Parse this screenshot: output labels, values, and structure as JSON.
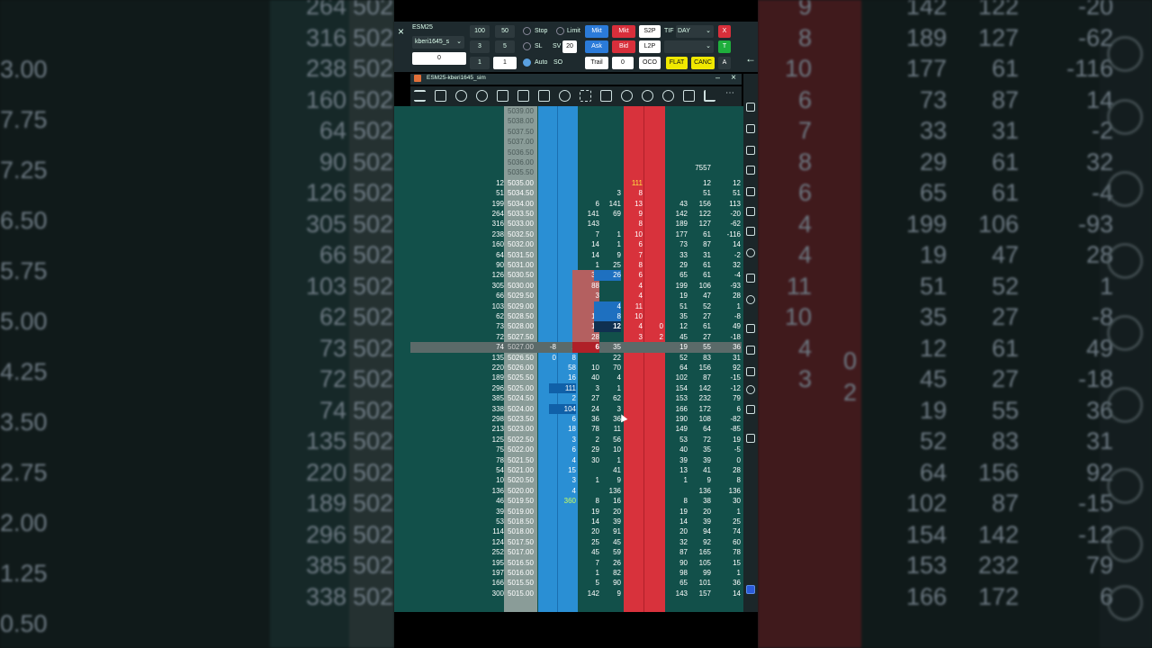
{
  "toolbar": {
    "symbol": "ESM25",
    "account": "kberi1645_s",
    "price_field": "0",
    "qty_presets": [
      "100",
      "50",
      "3",
      "5",
      "1"
    ],
    "qty_value": "1",
    "sv_label": "SV",
    "sv_value": "20",
    "stop_label": "Stop",
    "limit_label": "Limit",
    "sl_label": "SL",
    "auto_label": "Auto",
    "so_label": "SO",
    "mkt_buy": "Mkt",
    "mkt_sell": "Mkt",
    "ask": "Ask",
    "bid": "Bid",
    "trail": "Trail",
    "trail_value": "0",
    "s2p": "S2P",
    "l2p": "L2P",
    "oco": "OCO",
    "tif_label": "TIF",
    "tif_value": "DAY",
    "flat": "FLAT",
    "canc": "CANC",
    "a_label": "A",
    "x_label": "X",
    "t_label": "T",
    "close_icon": "×"
  },
  "window": {
    "title": "ESM25-kberi1645_sim",
    "logo_letter": "K"
  },
  "ladder": {
    "hidden_prices": [
      "5039.00",
      "5038.00",
      "5037.50",
      "5037.00",
      "5036.50",
      "5036.00",
      "5035.50"
    ],
    "total_volume": "7557",
    "rows": [
      {
        "vol": "12",
        "price": "5035.00",
        "a": "",
        "b": "",
        "c": "",
        "d": "",
        "ask": "111",
        "e": "",
        "f": "",
        "g": "12",
        "h": "12"
      },
      {
        "vol": "51",
        "price": "5034.50",
        "a": "",
        "b": "",
        "c": "",
        "d": "3",
        "ask": "8",
        "e": "",
        "f": "",
        "g": "51",
        "h": "51"
      },
      {
        "vol": "199",
        "price": "5034.00",
        "a": "",
        "b": "",
        "c": "6",
        "d": "141",
        "ask": "13",
        "e": "",
        "f": "43",
        "g": "156",
        "h": "113"
      },
      {
        "vol": "264",
        "price": "5033.50",
        "a": "",
        "b": "",
        "c": "141",
        "d": "69",
        "ask": "9",
        "e": "",
        "f": "142",
        "g": "122",
        "h": "-20"
      },
      {
        "vol": "316",
        "price": "5033.00",
        "a": "",
        "b": "",
        "c": "143",
        "d": "",
        "ask": "8",
        "e": "",
        "f": "189",
        "g": "127",
        "h": "-62"
      },
      {
        "vol": "238",
        "price": "5032.50",
        "a": "",
        "b": "",
        "c": "7",
        "d": "1",
        "ask": "10",
        "e": "",
        "f": "177",
        "g": "61",
        "h": "-116"
      },
      {
        "vol": "160",
        "price": "5032.00",
        "a": "",
        "b": "",
        "c": "14",
        "d": "1",
        "ask": "6",
        "e": "",
        "f": "73",
        "g": "87",
        "h": "14"
      },
      {
        "vol": "64",
        "price": "5031.50",
        "a": "",
        "b": "",
        "c": "14",
        "d": "9",
        "ask": "7",
        "e": "",
        "f": "33",
        "g": "31",
        "h": "-2"
      },
      {
        "vol": "90",
        "price": "5031.00",
        "a": "",
        "b": "",
        "c": "1",
        "d": "25",
        "ask": "8",
        "e": "",
        "f": "29",
        "g": "61",
        "h": "32"
      },
      {
        "vol": "126",
        "price": "5030.50",
        "a": "",
        "b": "",
        "c": "37",
        "d": "26",
        "ask": "6",
        "e": "",
        "f": "65",
        "g": "61",
        "h": "-4"
      },
      {
        "vol": "305",
        "price": "5030.00",
        "a": "",
        "b": "",
        "c": "88",
        "d": "",
        "ask": "4",
        "e": "",
        "f": "199",
        "g": "106",
        "h": "-93"
      },
      {
        "vol": "66",
        "price": "5029.50",
        "a": "",
        "b": "",
        "c": "3",
        "d": "",
        "ask": "4",
        "e": "",
        "f": "19",
        "g": "47",
        "h": "28"
      },
      {
        "vol": "103",
        "price": "5029.00",
        "a": "",
        "b": "",
        "c": "3",
        "d": "4",
        "ask": "11",
        "e": "",
        "f": "51",
        "g": "52",
        "h": "1"
      },
      {
        "vol": "62",
        "price": "5028.50",
        "a": "",
        "b": "",
        "c": "17",
        "d": "8",
        "ask": "10",
        "e": "",
        "f": "35",
        "g": "27",
        "h": "-8"
      },
      {
        "vol": "73",
        "price": "5028.00",
        "a": "",
        "b": "",
        "c": "12",
        "d": "12",
        "ask": "4",
        "e": "0",
        "f": "12",
        "g": "61",
        "h": "49"
      },
      {
        "vol": "72",
        "price": "5027.50",
        "a": "",
        "b": "",
        "c": "28",
        "d": "",
        "ask": "3",
        "e": "2",
        "f": "45",
        "g": "27",
        "h": "-18"
      },
      {
        "vol": "74",
        "price": "5027.00",
        "a": "-8",
        "b": "2",
        "c": "6",
        "d": "35",
        "ask": "",
        "e": "",
        "f": "19",
        "g": "55",
        "h": "36"
      },
      {
        "vol": "135",
        "price": "5026.50",
        "a": "0",
        "b": "8",
        "c": "",
        "d": "22",
        "ask": "",
        "e": "",
        "f": "52",
        "g": "83",
        "h": "31"
      },
      {
        "vol": "220",
        "price": "5026.00",
        "a": "",
        "b": "58",
        "c": "10",
        "d": "70",
        "ask": "",
        "e": "",
        "f": "64",
        "g": "156",
        "h": "92"
      },
      {
        "vol": "189",
        "price": "5025.50",
        "a": "",
        "b": "16",
        "c": "40",
        "d": "4",
        "ask": "",
        "e": "",
        "f": "102",
        "g": "87",
        "h": "-15"
      },
      {
        "vol": "296",
        "price": "5025.00",
        "a": "",
        "b": "111",
        "c": "3",
        "d": "1",
        "ask": "",
        "e": "",
        "f": "154",
        "g": "142",
        "h": "-12"
      },
      {
        "vol": "385",
        "price": "5024.50",
        "a": "",
        "b": "2",
        "c": "27",
        "d": "62",
        "ask": "",
        "e": "",
        "f": "153",
        "g": "232",
        "h": "79"
      },
      {
        "vol": "338",
        "price": "5024.00",
        "a": "",
        "b": "104",
        "c": "24",
        "d": "3",
        "ask": "",
        "e": "",
        "f": "166",
        "g": "172",
        "h": "6"
      },
      {
        "vol": "298",
        "price": "5023.50",
        "a": "",
        "b": "6",
        "c": "36",
        "d": "36",
        "ask": "",
        "e": "",
        "f": "190",
        "g": "108",
        "h": "-82"
      },
      {
        "vol": "213",
        "price": "5023.00",
        "a": "",
        "b": "18",
        "c": "78",
        "d": "11",
        "ask": "",
        "e": "",
        "f": "149",
        "g": "64",
        "h": "-85"
      },
      {
        "vol": "125",
        "price": "5022.50",
        "a": "",
        "b": "3",
        "c": "2",
        "d": "56",
        "ask": "",
        "e": "",
        "f": "53",
        "g": "72",
        "h": "19"
      },
      {
        "vol": "75",
        "price": "5022.00",
        "a": "",
        "b": "6",
        "c": "29",
        "d": "10",
        "ask": "",
        "e": "",
        "f": "40",
        "g": "35",
        "h": "-5"
      },
      {
        "vol": "78",
        "price": "5021.50",
        "a": "",
        "b": "4",
        "c": "30",
        "d": "1",
        "ask": "",
        "e": "",
        "f": "39",
        "g": "39",
        "h": "0"
      },
      {
        "vol": "54",
        "price": "5021.00",
        "a": "",
        "b": "15",
        "c": "",
        "d": "41",
        "ask": "",
        "e": "",
        "f": "13",
        "g": "41",
        "h": "28"
      },
      {
        "vol": "10",
        "price": "5020.50",
        "a": "",
        "b": "3",
        "c": "1",
        "d": "9",
        "ask": "",
        "e": "",
        "f": "1",
        "g": "9",
        "h": "8"
      },
      {
        "vol": "136",
        "price": "5020.00",
        "a": "",
        "b": "4",
        "c": "",
        "d": "136",
        "ask": "",
        "e": "",
        "f": "",
        "g": "136",
        "h": "136"
      },
      {
        "vol": "46",
        "price": "5019.50",
        "a": "",
        "b": "360",
        "c": "8",
        "d": "16",
        "ask": "",
        "e": "",
        "f": "8",
        "g": "38",
        "h": "30"
      },
      {
        "vol": "39",
        "price": "5019.00",
        "a": "",
        "b": "",
        "c": "19",
        "d": "20",
        "ask": "",
        "e": "",
        "f": "19",
        "g": "20",
        "h": "1"
      },
      {
        "vol": "53",
        "price": "5018.50",
        "a": "",
        "b": "",
        "c": "14",
        "d": "39",
        "ask": "",
        "e": "",
        "f": "14",
        "g": "39",
        "h": "25"
      },
      {
        "vol": "114",
        "price": "5018.00",
        "a": "",
        "b": "",
        "c": "20",
        "d": "91",
        "ask": "",
        "e": "",
        "f": "20",
        "g": "94",
        "h": "74"
      },
      {
        "vol": "124",
        "price": "5017.50",
        "a": "",
        "b": "",
        "c": "25",
        "d": "45",
        "ask": "",
        "e": "",
        "f": "32",
        "g": "92",
        "h": "60"
      },
      {
        "vol": "252",
        "price": "5017.00",
        "a": "",
        "b": "",
        "c": "45",
        "d": "59",
        "ask": "",
        "e": "",
        "f": "87",
        "g": "165",
        "h": "78"
      },
      {
        "vol": "195",
        "price": "5016.50",
        "a": "",
        "b": "",
        "c": "7",
        "d": "26",
        "ask": "",
        "e": "",
        "f": "90",
        "g": "105",
        "h": "15"
      },
      {
        "vol": "197",
        "price": "5016.00",
        "a": "",
        "b": "",
        "c": "1",
        "d": "82",
        "ask": "",
        "e": "",
        "f": "98",
        "g": "99",
        "h": "1"
      },
      {
        "vol": "166",
        "price": "5015.50",
        "a": "",
        "b": "",
        "c": "5",
        "d": "90",
        "ask": "",
        "e": "",
        "f": "65",
        "g": "101",
        "h": "36"
      },
      {
        "vol": "300",
        "price": "5015.00",
        "a": "",
        "b": "",
        "c": "142",
        "d": "9",
        "ask": "",
        "e": "",
        "f": "143",
        "g": "157",
        "h": "14"
      }
    ]
  },
  "bg_left_rows": [
    {
      "a": "264",
      "b": "502"
    },
    {
      "a": "316",
      "b": "502"
    },
    {
      "a": "238",
      "b": "502"
    },
    {
      "a": "160",
      "b": "502"
    },
    {
      "a": "64",
      "b": "502"
    },
    {
      "a": "90",
      "b": "502"
    },
    {
      "a": "126",
      "b": "502"
    },
    {
      "a": "305",
      "b": "502"
    },
    {
      "a": "66",
      "b": "502"
    },
    {
      "a": "103",
      "b": "502"
    },
    {
      "a": "62",
      "b": "502"
    },
    {
      "a": "73",
      "b": "502"
    },
    {
      "a": "72",
      "b": "502"
    },
    {
      "a": "74",
      "b": "502"
    },
    {
      "a": "135",
      "b": "502"
    },
    {
      "a": "220",
      "b": "502"
    },
    {
      "a": "189",
      "b": "502"
    },
    {
      "a": "296",
      "b": "502"
    },
    {
      "a": "385",
      "b": "502"
    },
    {
      "a": "338",
      "b": "502"
    }
  ],
  "bg_left_prices": [
    "3.00",
    "7.75",
    "7.25",
    "6.50",
    "5.75",
    "5.00",
    "4.25",
    "3.50",
    "2.75",
    "2.00",
    "1.25",
    "0.50"
  ],
  "bg_right_rows": [
    {
      "a": "9",
      "b": "142",
      "c": "122",
      "d": "-20"
    },
    {
      "a": "8",
      "b": "189",
      "c": "127",
      "d": "-62"
    },
    {
      "a": "10",
      "b": "177",
      "c": "61",
      "d": "-116"
    },
    {
      "a": "6",
      "b": "73",
      "c": "87",
      "d": "14"
    },
    {
      "a": "7",
      "b": "33",
      "c": "31",
      "d": "-2"
    },
    {
      "a": "8",
      "b": "29",
      "c": "61",
      "d": "32"
    },
    {
      "a": "6",
      "b": "65",
      "c": "61",
      "d": "-4"
    },
    {
      "a": "4",
      "b": "199",
      "c": "106",
      "d": "-93"
    },
    {
      "a": "4",
      "b": "19",
      "c": "47",
      "d": "28"
    },
    {
      "a": "11",
      "b": "51",
      "c": "52",
      "d": "1"
    },
    {
      "a": "10",
      "b": "35",
      "c": "27",
      "d": "-8"
    },
    {
      "a": "4",
      "b": "12",
      "c": "61",
      "d": "49"
    },
    {
      "a": "3",
      "b": "45",
      "c": "27",
      "d": "-18"
    },
    {
      "a": "",
      "b": "19",
      "c": "55",
      "d": "36"
    },
    {
      "a": "",
      "b": "52",
      "c": "83",
      "d": "31"
    },
    {
      "a": "",
      "b": "64",
      "c": "156",
      "d": "92"
    },
    {
      "a": "",
      "b": "102",
      "c": "87",
      "d": "-15"
    },
    {
      "a": "",
      "b": "154",
      "c": "142",
      "d": "-12"
    },
    {
      "a": "",
      "b": "153",
      "c": "232",
      "d": "79"
    },
    {
      "a": "",
      "b": "166",
      "c": "172",
      "d": "6"
    }
  ],
  "bg_right_extra": {
    "zero": "0",
    "two": "2"
  },
  "colors": {
    "bid_blue": "#2a8fd4",
    "ask_red": "#d8323c",
    "ladder_bg": "#12504a",
    "price_col": "#8a9c98",
    "highlight": "#5b6a69",
    "flat_yellow": "#f0e800",
    "buy_blue": "#2b7bd9",
    "sell_red": "#d82f3b",
    "green": "#1fae3c"
  }
}
